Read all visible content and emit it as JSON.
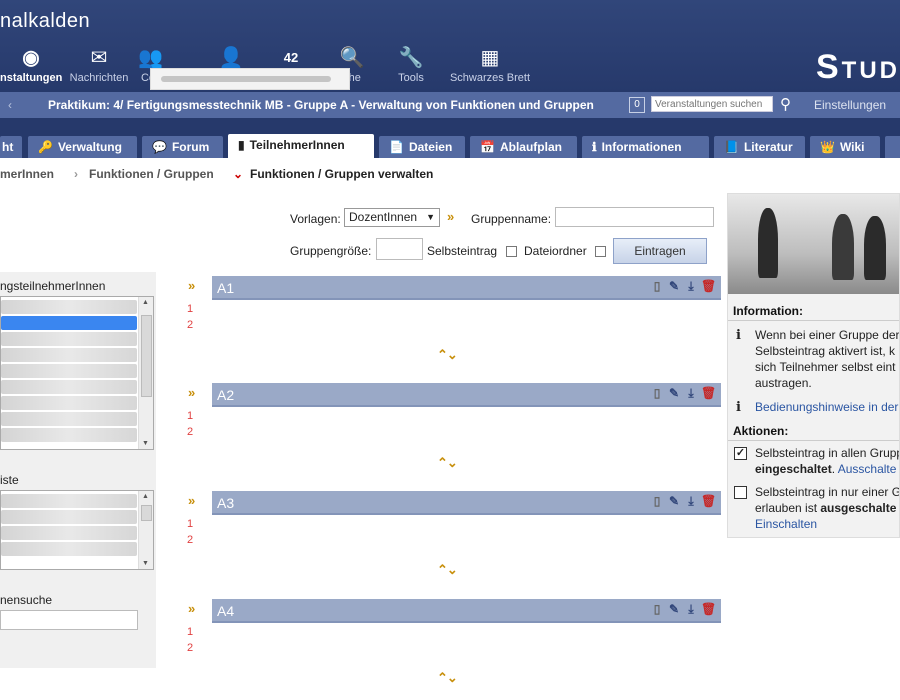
{
  "app": {
    "title": "nalkalden",
    "logo": "Stud"
  },
  "nav": [
    {
      "label": "nstaltungen",
      "icon": "◉",
      "icon_name": "courses-icon",
      "active": true
    },
    {
      "label": "Nachrichten",
      "icon": "✉",
      "icon_name": "messages-icon"
    },
    {
      "label": "Co",
      "icon": "👥",
      "icon_name": "community-icon"
    },
    {
      "label": "",
      "icon": "👤",
      "icon_name": "profile-icon"
    },
    {
      "label": "",
      "icon": "42",
      "icon_name": "calendar-icon"
    },
    {
      "label": "che",
      "icon": "🔍",
      "icon_name": "search-icon"
    },
    {
      "label": "Tools",
      "icon": "🔧",
      "icon_name": "tools-icon"
    },
    {
      "label": "Schwarzes Brett",
      "icon": "▦",
      "icon_name": "bulletin-board-icon"
    }
  ],
  "courseBar": {
    "back": "‹",
    "title": "Praktikum: 4/ Fertigungsmesstechnik MB - Gruppe A - Verwaltung von Funktionen und Gruppen",
    "count": "0",
    "searchPlaceholder": "Veranstaltungen suchen",
    "settings": "Einstellungen"
  },
  "tabs": [
    {
      "label": "ht",
      "icon": ""
    },
    {
      "label": "Verwaltung",
      "icon": "🔑"
    },
    {
      "label": "Forum",
      "icon": "💬"
    },
    {
      "label": "TeilnehmerInnen",
      "icon": "▮",
      "active": true
    },
    {
      "label": "Dateien",
      "icon": "📄"
    },
    {
      "label": "Ablaufplan",
      "icon": "📅"
    },
    {
      "label": "Informationen",
      "icon": "ℹ"
    },
    {
      "label": "Literatur",
      "icon": "📘"
    },
    {
      "label": "Wiki",
      "icon": "👑"
    }
  ],
  "subnav": {
    "item1": "merInnen",
    "item2": "Funktionen / Gruppen",
    "item3": "Funktionen / Gruppen verwalten"
  },
  "form": {
    "vorlagenLabel": "Vorlagen:",
    "vorlagenValue": "DozentInnen",
    "gruppennameLabel": "Gruppenname:",
    "gruppengroesseLabel": "Gruppengröße:",
    "selbsteintragLabel": "Selbsteintrag",
    "dateiordnerLabel": "Dateiordner",
    "submit": "Eintragen"
  },
  "leftPanel": {
    "head1": "ngsteilnehmerInnen",
    "head2": "iste",
    "head3": "nensuche"
  },
  "groups": [
    {
      "name": "A1",
      "nums": [
        "1",
        "2"
      ]
    },
    {
      "name": "A2",
      "nums": [
        "1",
        "2"
      ]
    },
    {
      "name": "A3",
      "nums": [
        "1",
        "2"
      ]
    },
    {
      "name": "A4",
      "nums": [
        "1",
        "2"
      ]
    }
  ],
  "sidebar": {
    "infoHead": "Information:",
    "info1": [
      "Wenn bei einer Gruppe der",
      "Selbsteintrag aktivert ist, k",
      "sich Teilnehmer selbst eint",
      "austragen."
    ],
    "info2": "Bedienungshinweise in der",
    "actionsHead": "Aktionen:",
    "act1a": "Selbsteintrag in allen Grupp",
    "act1b": "eingeschaltet",
    "act1c": "Ausschalte",
    "act2a": "Selbsteintrag in nur einer G",
    "act2b": "erlauben ist ",
    "act2bold": "ausgeschalte",
    "act2c": "Einschalten"
  }
}
